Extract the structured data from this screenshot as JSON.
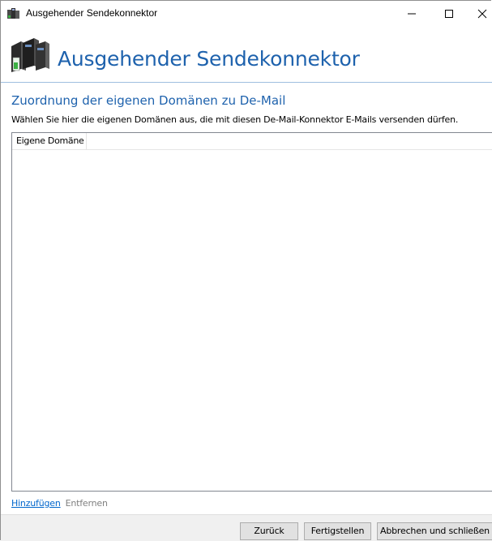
{
  "window": {
    "title": "Ausgehender Sendekonnektor",
    "minimize_glyph": "—",
    "maximize_glyph": "☐",
    "close_glyph": "✕"
  },
  "header": {
    "title": "Ausgehender Sendekonnektor",
    "icon": "server-connector-icon",
    "title_color": "#1e62ad"
  },
  "section": {
    "title": "Zuordnung der eigenen Domänen zu De-Mail",
    "description": "Wählen Sie hier die eigenen Domänen aus, die mit diesen De-Mail-Konnektor E-Mails versenden dürfen."
  },
  "domain_list": {
    "columns": [
      "Eigene Domäne"
    ],
    "rows": []
  },
  "links": {
    "add": "Hinzufügen",
    "remove": "Entfernen"
  },
  "buttons": {
    "back": "Zurück",
    "finish": "Fertigstellen",
    "cancel": "Abbrechen und schließen"
  },
  "colors": {
    "accent": "#1e62ad",
    "link": "#0066cc",
    "footer_bg": "#f0f0f0"
  }
}
